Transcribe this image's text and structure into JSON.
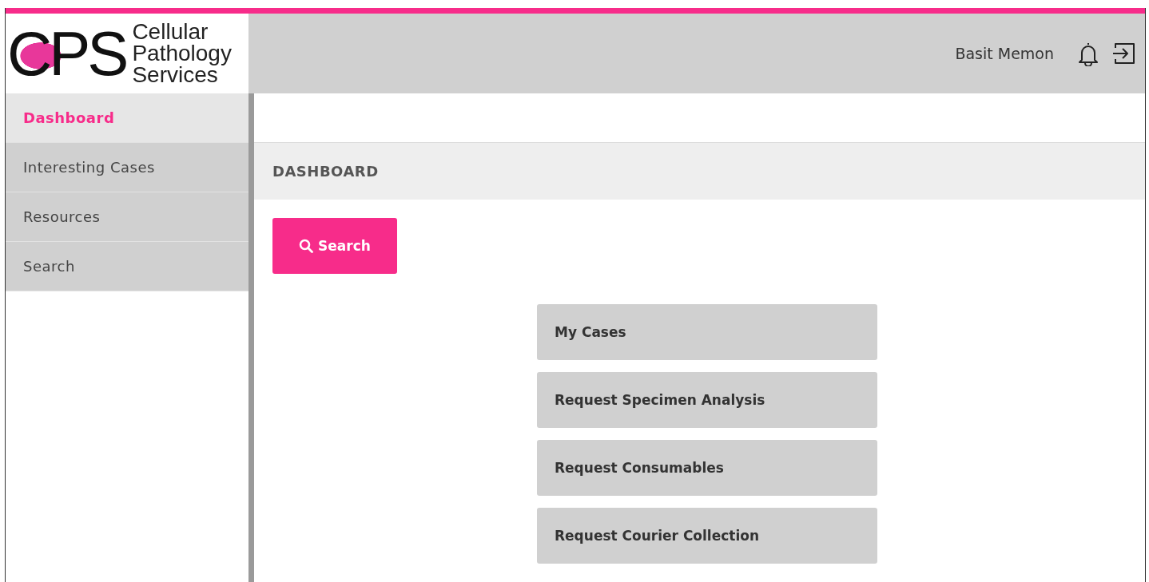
{
  "logo": {
    "mark": "CPS",
    "lines": [
      "Cellular",
      "Pathology",
      "Services"
    ]
  },
  "header": {
    "user": "Basit Memon"
  },
  "sidebar": {
    "items": [
      {
        "label": "Dashboard",
        "selected": true
      },
      {
        "label": "Interesting Cases",
        "selected": false
      },
      {
        "label": "Resources",
        "selected": false
      },
      {
        "label": "Search",
        "selected": false
      }
    ]
  },
  "page_title": "DASHBOARD",
  "search_button": "Search",
  "actions": [
    "My Cases",
    "Request Specimen Analysis",
    "Request Consumables",
    "Request Courier Collection"
  ]
}
